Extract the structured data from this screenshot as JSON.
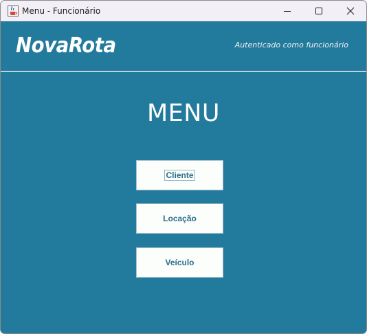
{
  "window": {
    "title": "Menu - Funcionário"
  },
  "header": {
    "logo_text": "NovaRota",
    "auth_status": "Autenticado como funcionário"
  },
  "main": {
    "title": "MENU",
    "buttons": [
      {
        "label": "Cliente",
        "focused": true
      },
      {
        "label": "Locação",
        "focused": false
      },
      {
        "label": "Veículo",
        "focused": false
      }
    ]
  },
  "colors": {
    "background": "#227a9c",
    "titlebar": "#f3eff6",
    "button_background": "#fbfefb",
    "button_text": "#2b6e8e",
    "divider": "#b9d3df"
  },
  "icons": {
    "app": "java-coffee-icon",
    "minimize": "minimize-icon",
    "maximize": "maximize-icon",
    "close": "close-icon"
  }
}
